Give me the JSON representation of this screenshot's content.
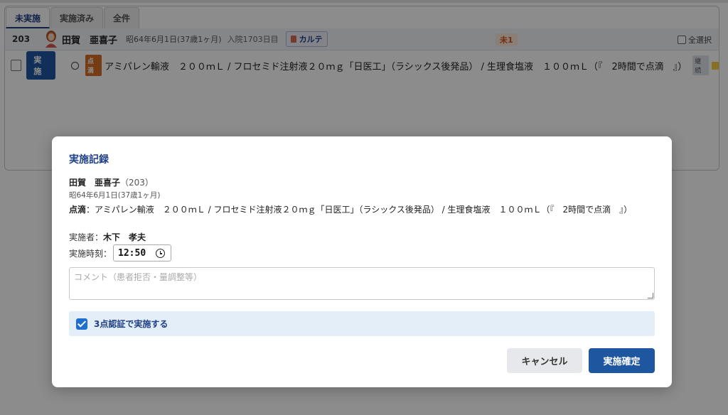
{
  "tabs": [
    {
      "label": "未実施",
      "active": true
    },
    {
      "label": "実施済み",
      "active": false
    },
    {
      "label": "全件",
      "active": false
    }
  ],
  "patient_bar": {
    "room": "203",
    "name": "田賀　亜喜子",
    "dob": "昭64年6月1日(37歳1ヶ月)",
    "admission": "入院1703日目",
    "karte_label": "カルテ",
    "pending_badge": "未1",
    "select_all_label": "全選択"
  },
  "order_row": {
    "do_label": "実施",
    "type_badge": "点滴",
    "text": "アミパレン輸液　２００ｍＬ / フロセミド注射液２０ｍｇ「日医工」（ラシックス後発品） / 生理食塩液　１００ｍＬ（『　2時間で点滴　』）",
    "continuation_badge": "継続"
  },
  "modal": {
    "title": "実施記録",
    "patient_name": "田賀　亜喜子",
    "patient_room": "（203）",
    "patient_dob": "昭64年6月1日(37歳1ヶ月)",
    "order_type_label": "点滴",
    "order_text": "：アミパレン輸液　２００ｍＬ / フロセミド注射液２０ｍｇ「日医工」（ラシックス後発品） / 生理食塩液　１００ｍＬ（『　2時間で点滴　』）",
    "performer_label": "実施者：",
    "performer_name": "木下　孝夫",
    "time_label": "実施時刻：",
    "time_value": "12:50",
    "comment_placeholder": "コメント（患者拒否・量調整等）",
    "three_point_label": "3点認証で実施する",
    "three_point_checked": true,
    "cancel_label": "キャンセル",
    "confirm_label": "実施確定"
  },
  "colors": {
    "accent": "#1f56a0",
    "title": "#1f3f86",
    "badge_orange": "#d86e24"
  }
}
